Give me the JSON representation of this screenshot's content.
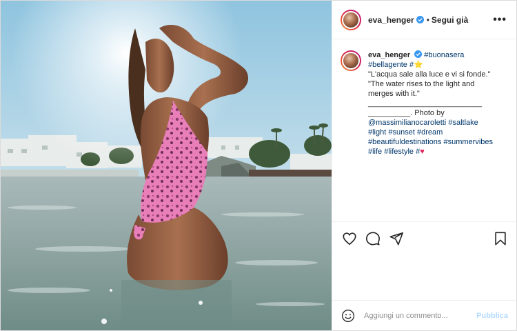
{
  "header": {
    "username": "eva_henger",
    "separator": "•",
    "follow_label": "Segui già",
    "more_label": "•••"
  },
  "caption": {
    "username": "eva_henger",
    "line1_tag": "#buonasera",
    "line2_tag1": "#bellagente",
    "line2_tag2": "#",
    "quote_it": "\"L'acqua sale alla luce e vi si fonde.\"",
    "quote_en_1": "\"The water rises to the light and",
    "quote_en_2": "merges with it.\"",
    "rule_1": "___________________________",
    "rule_2": "__________. Photo by",
    "mention": "@massimilianocaroletti",
    "tag_saltlake": "#saltlake",
    "tag_light": "#light",
    "tag_sunset": "#sunset",
    "tag_dream": "#dream",
    "tag_beautiful": "#beautifuldestinations",
    "tag_summervibes": "#summervibes",
    "tag_life": "#life",
    "tag_lifestyle": "#lifestyle",
    "tag_last": "#",
    "heart_glyph": "♥",
    "star_glyph": "⭐"
  },
  "actions": {
    "like_icon": "heart-icon",
    "comment_icon": "comment-icon",
    "share_icon": "share-icon",
    "save_icon": "bookmark-icon"
  },
  "comment": {
    "placeholder": "Aggiungi un commento...",
    "publish_label": "Pubblica"
  },
  "colors": {
    "link": "#00376b",
    "verified": "#3897f0",
    "publish_disabled": "#b3dbff"
  }
}
